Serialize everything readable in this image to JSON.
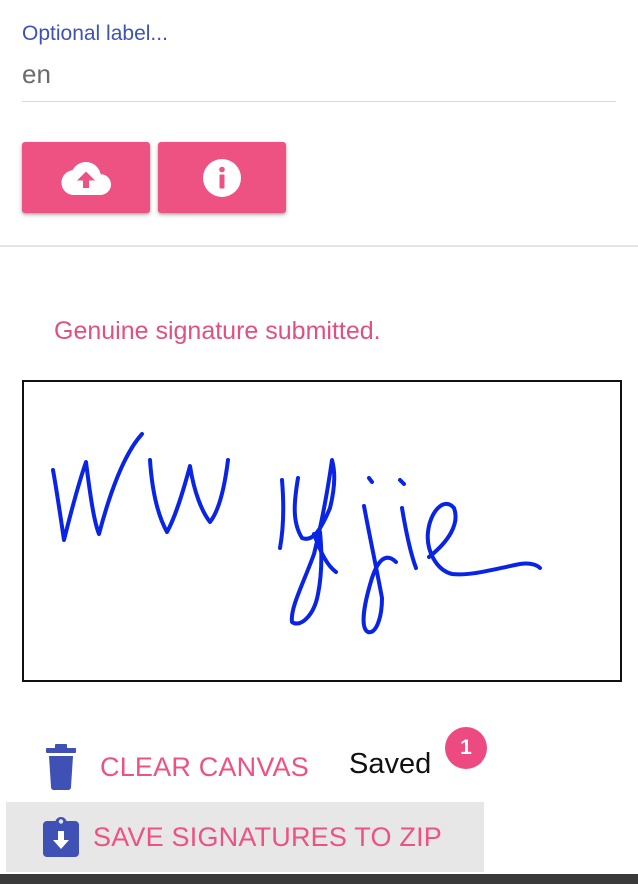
{
  "label_field": {
    "label": "Optional label...",
    "value": "en"
  },
  "buttons": {
    "upload_icon": "cloud-upload-icon",
    "info_icon": "info-icon"
  },
  "status": {
    "message": "Genuine signature submitted."
  },
  "signature": {
    "stroke_color": "#0a24e6"
  },
  "actions": {
    "clear_label": "CLEAR CANVAS",
    "clear_icon": "trash-icon",
    "saved_label": "Saved",
    "saved_count": "1",
    "save_zip_label": "SAVE SIGNATURES TO ZIP",
    "save_zip_icon": "clipboard-download-icon"
  },
  "colors": {
    "accent": "#ee5283",
    "primary": "#3f51b5"
  }
}
